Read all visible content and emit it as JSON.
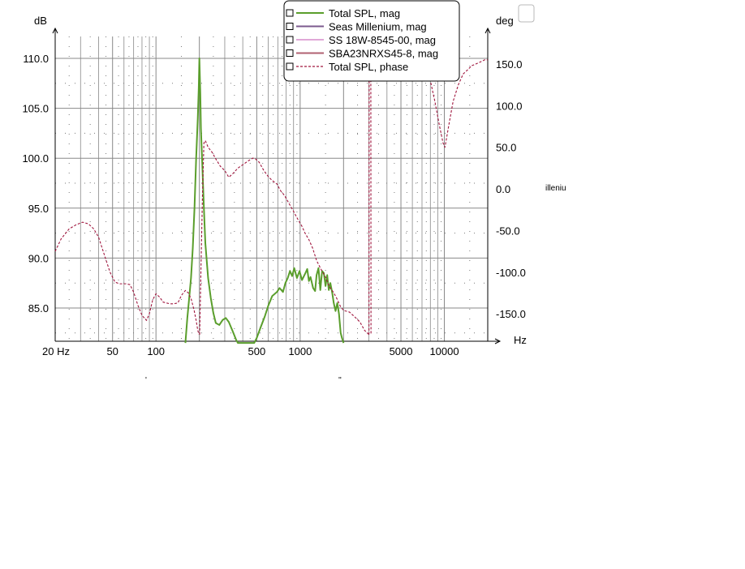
{
  "chart_data": {
    "type": "line",
    "left_unit": "dB",
    "right_unit": "deg",
    "x_unit": "Hz",
    "xscale": "log",
    "xlim": [
      20,
      20000
    ],
    "ylim_left": [
      81.5,
      112.5
    ],
    "ylim_right": [
      -175,
      180
    ],
    "grid": true,
    "legend_position": "top-center",
    "x_ticks": [
      {
        "value": 20,
        "label": "20 Hz"
      },
      {
        "value": 50,
        "label": "50"
      },
      {
        "value": 100,
        "label": "100"
      },
      {
        "value": 500,
        "label": "500"
      },
      {
        "value": 1000,
        "label": "1000"
      },
      {
        "value": 5000,
        "label": "5000"
      },
      {
        "value": 10000,
        "label": "10000"
      }
    ],
    "y_left_ticks": [
      {
        "value": 110,
        "label": "110.0"
      },
      {
        "value": 105,
        "label": "105.0"
      },
      {
        "value": 100,
        "label": "100.0"
      },
      {
        "value": 95,
        "label": "95.0"
      },
      {
        "value": 90,
        "label": "90.0"
      },
      {
        "value": 85,
        "label": "85.0"
      }
    ],
    "y_right_ticks": [
      {
        "value": 150,
        "label": "150.0"
      },
      {
        "value": 100,
        "label": "100.0"
      },
      {
        "value": 50,
        "label": "50.0"
      },
      {
        "value": 0,
        "label": "0.0"
      },
      {
        "value": -50,
        "label": "-50.0"
      },
      {
        "value": -100,
        "label": "-100.0"
      },
      {
        "value": -150,
        "label": "-150.0"
      }
    ],
    "series": [
      {
        "name": "Total SPL, mag",
        "axis": "left",
        "color": "#5a9e2c",
        "style": "solid",
        "points": [
          [
            160,
            81.5
          ],
          [
            165,
            84
          ],
          [
            170,
            86
          ],
          [
            175,
            88
          ],
          [
            180,
            91
          ],
          [
            185,
            95
          ],
          [
            190,
            100
          ],
          [
            195,
            104
          ],
          [
            198,
            107
          ],
          [
            200,
            110
          ],
          [
            203,
            106.5
          ],
          [
            205,
            103
          ],
          [
            210,
            99
          ],
          [
            215,
            95
          ],
          [
            220,
            91.5
          ],
          [
            230,
            88
          ],
          [
            240,
            86
          ],
          [
            250,
            84.5
          ],
          [
            260,
            83.5
          ],
          [
            275,
            83.3
          ],
          [
            290,
            83.8
          ],
          [
            305,
            84
          ],
          [
            320,
            83.6
          ],
          [
            340,
            82.7
          ],
          [
            360,
            81.8
          ],
          [
            370,
            81.5
          ],
          [
            480,
            81.5
          ],
          [
            500,
            82
          ],
          [
            530,
            83
          ],
          [
            570,
            84.2
          ],
          [
            600,
            85.2
          ],
          [
            640,
            86.2
          ],
          [
            690,
            86.6
          ],
          [
            720,
            87
          ],
          [
            760,
            86.6
          ],
          [
            790,
            87.5
          ],
          [
            820,
            88
          ],
          [
            850,
            88.7
          ],
          [
            880,
            88.2
          ],
          [
            910,
            89
          ],
          [
            950,
            88
          ],
          [
            990,
            88.7
          ],
          [
            1030,
            87.8
          ],
          [
            1080,
            88.4
          ],
          [
            1120,
            88.9
          ],
          [
            1150,
            87.7
          ],
          [
            1180,
            88.1
          ],
          [
            1230,
            87
          ],
          [
            1270,
            86.7
          ],
          [
            1300,
            88.3
          ],
          [
            1340,
            89
          ],
          [
            1380,
            86.8
          ],
          [
            1420,
            88.7
          ],
          [
            1460,
            88.5
          ],
          [
            1500,
            87.2
          ],
          [
            1540,
            88.3
          ],
          [
            1580,
            86.8
          ],
          [
            1620,
            87.5
          ],
          [
            1670,
            86.5
          ],
          [
            1710,
            85.5
          ],
          [
            1760,
            84.7
          ],
          [
            1810,
            85.5
          ],
          [
            1860,
            84.4
          ],
          [
            1910,
            82.5
          ],
          [
            1950,
            82
          ],
          [
            2000,
            81.5
          ]
        ]
      },
      {
        "name": "Seas Millenium, mag",
        "axis": "left",
        "color": "#7b5a8e",
        "style": "solid",
        "points": []
      },
      {
        "name": "SS 18W-8545-00, mag",
        "axis": "left",
        "color": "#e0a8d8",
        "style": "solid",
        "points": []
      },
      {
        "name": "SBA23NRXS45-8, mag",
        "axis": "left",
        "color": "#b06070",
        "style": "solid",
        "points": []
      },
      {
        "name": "Total SPL, phase",
        "axis": "right",
        "color": "#a0163e",
        "style": "dashed",
        "segments": [
          [
            [
              20,
              -75
            ],
            [
              22,
              -60
            ],
            [
              25,
              -48
            ],
            [
              28,
              -43
            ],
            [
              31,
              -40
            ],
            [
              34,
              -42
            ],
            [
              37,
              -48
            ],
            [
              40,
              -58
            ],
            [
              44,
              -80
            ],
            [
              48,
              -100
            ],
            [
              52,
              -112
            ],
            [
              56,
              -114
            ],
            [
              62,
              -114
            ],
            [
              66,
              -115
            ],
            [
              70,
              -124
            ],
            [
              75,
              -140
            ],
            [
              80,
              -152
            ],
            [
              86,
              -158
            ],
            [
              90,
              -150
            ],
            [
              95,
              -133
            ],
            [
              100,
              -126
            ],
            [
              106,
              -130
            ],
            [
              112,
              -136
            ],
            [
              118,
              -137
            ],
            [
              125,
              -138
            ],
            [
              133,
              -138
            ],
            [
              142,
              -137
            ],
            [
              150,
              -128
            ],
            [
              160,
              -122
            ],
            [
              168,
              -125
            ],
            [
              176,
              -133
            ],
            [
              184,
              -146
            ],
            [
              190,
              -158
            ],
            [
              195,
              -170
            ],
            [
              199,
              -175
            ]
          ],
          [
            [
              201,
              -175
            ],
            [
              205,
              -100
            ],
            [
              210,
              -10
            ],
            [
              215,
              55
            ],
            [
              220,
              58
            ],
            [
              230,
              50
            ],
            [
              245,
              44
            ],
            [
              260,
              36
            ],
            [
              280,
              27
            ],
            [
              300,
              22
            ],
            [
              320,
              14
            ],
            [
              340,
              18
            ],
            [
              370,
              25
            ],
            [
              400,
              29
            ],
            [
              440,
              34
            ],
            [
              470,
              37
            ],
            [
              490,
              36
            ],
            [
              520,
              32
            ],
            [
              560,
              22
            ],
            [
              600,
              15
            ],
            [
              640,
              10
            ],
            [
              690,
              6
            ],
            [
              730,
              -2
            ],
            [
              780,
              -8
            ],
            [
              840,
              -18
            ],
            [
              900,
              -27
            ],
            [
              960,
              -36
            ],
            [
              1030,
              -45
            ],
            [
              1080,
              -53
            ],
            [
              1150,
              -61
            ],
            [
              1220,
              -71
            ],
            [
              1300,
              -86
            ],
            [
              1400,
              -97
            ],
            [
              1500,
              -106
            ],
            [
              1600,
              -118
            ],
            [
              1700,
              -124
            ],
            [
              1800,
              -132
            ],
            [
              1900,
              -141
            ],
            [
              2000,
              -146
            ],
            [
              2200,
              -148
            ],
            [
              2400,
              -154
            ],
            [
              2600,
              -160
            ],
            [
              2800,
              -170
            ],
            [
              3000,
              -175
            ]
          ],
          [
            [
              3000,
              -175
            ],
            [
              3010,
              175
            ]
          ],
          [
            [
              3090,
              175
            ],
            [
              3100,
              -175
            ]
          ],
          [
            [
              7100,
              180
            ],
            [
              7400,
              150
            ],
            [
              8000,
              130
            ],
            [
              8600,
              105
            ],
            [
              9200,
              78
            ],
            [
              9800,
              55
            ],
            [
              10100,
              50
            ],
            [
              10700,
              75
            ],
            [
              11500,
              105
            ],
            [
              12500,
              125
            ],
            [
              13500,
              138
            ],
            [
              14500,
              143
            ],
            [
              15500,
              148
            ],
            [
              16500,
              150
            ],
            [
              17500,
              152
            ],
            [
              19000,
              155
            ],
            [
              20000,
              155
            ]
          ]
        ]
      }
    ]
  },
  "stray_labels": {
    "right_clip": "illeniu",
    "tick_a": "'",
    "tick_b": "''"
  }
}
